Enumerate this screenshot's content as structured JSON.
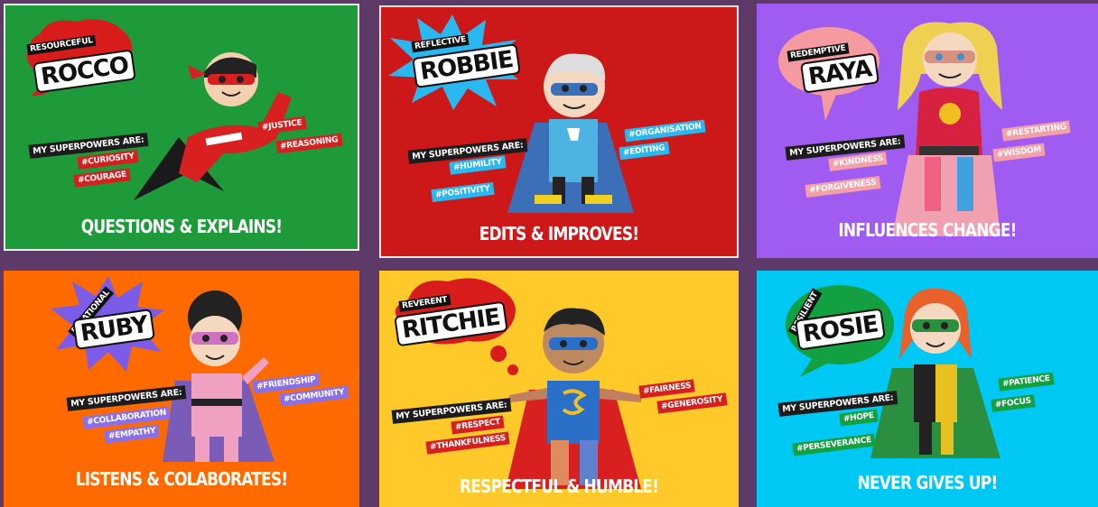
{
  "common": {
    "superpowers_label": "MY SUPERPOWERS ARE:"
  },
  "cards": [
    {
      "adjective": "RESOURCEFUL",
      "name": "ROCCO",
      "tags": [
        "#CURIOSITY",
        "#COURAGE",
        "#JUSTICE",
        "#REASONING"
      ],
      "motto": "QUESTIONS & EXPLAINS!",
      "color": "#1e9a3a"
    },
    {
      "adjective": "REFLECTIVE",
      "name": "ROBBIE",
      "tags": [
        "#HUMILITY",
        "#POSITIVITY",
        "#ORGANISATION",
        "#EDITING"
      ],
      "motto": "EDITS & IMPROVES!",
      "color": "#cc1818"
    },
    {
      "adjective": "REDEMPTIVE",
      "name": "RAYA",
      "tags": [
        "#KINDNESS",
        "#FORGIVENESS",
        "#RESTARTING",
        "#WISDOM"
      ],
      "motto": "INFLUENCES CHANGE!",
      "color": "#a05cf0"
    },
    {
      "adjective": "RELATIONAL",
      "name": "RUBY",
      "tags": [
        "#COLLABORATION",
        "#EMPATHY",
        "#FRIENDSHIP",
        "#COMMUNITY"
      ],
      "motto": "LISTENS & COLABORATES!",
      "color": "#ff6a00"
    },
    {
      "adjective": "REVERENT",
      "name": "RITCHIE",
      "tags": [
        "#RESPECT",
        "#THANKFULNESS",
        "#FAIRNESS",
        "#GENEROSITY"
      ],
      "motto": "RESPECTFUL & HUMBLE!",
      "color": "#ffc92a"
    },
    {
      "adjective": "RESILIENT",
      "name": "ROSIE",
      "tags": [
        "#HOPE",
        "#PERSEVERANCE",
        "#PATIENCE",
        "#FOCUS"
      ],
      "motto": "NEVER GIVES UP!",
      "color": "#00c8f4"
    }
  ]
}
